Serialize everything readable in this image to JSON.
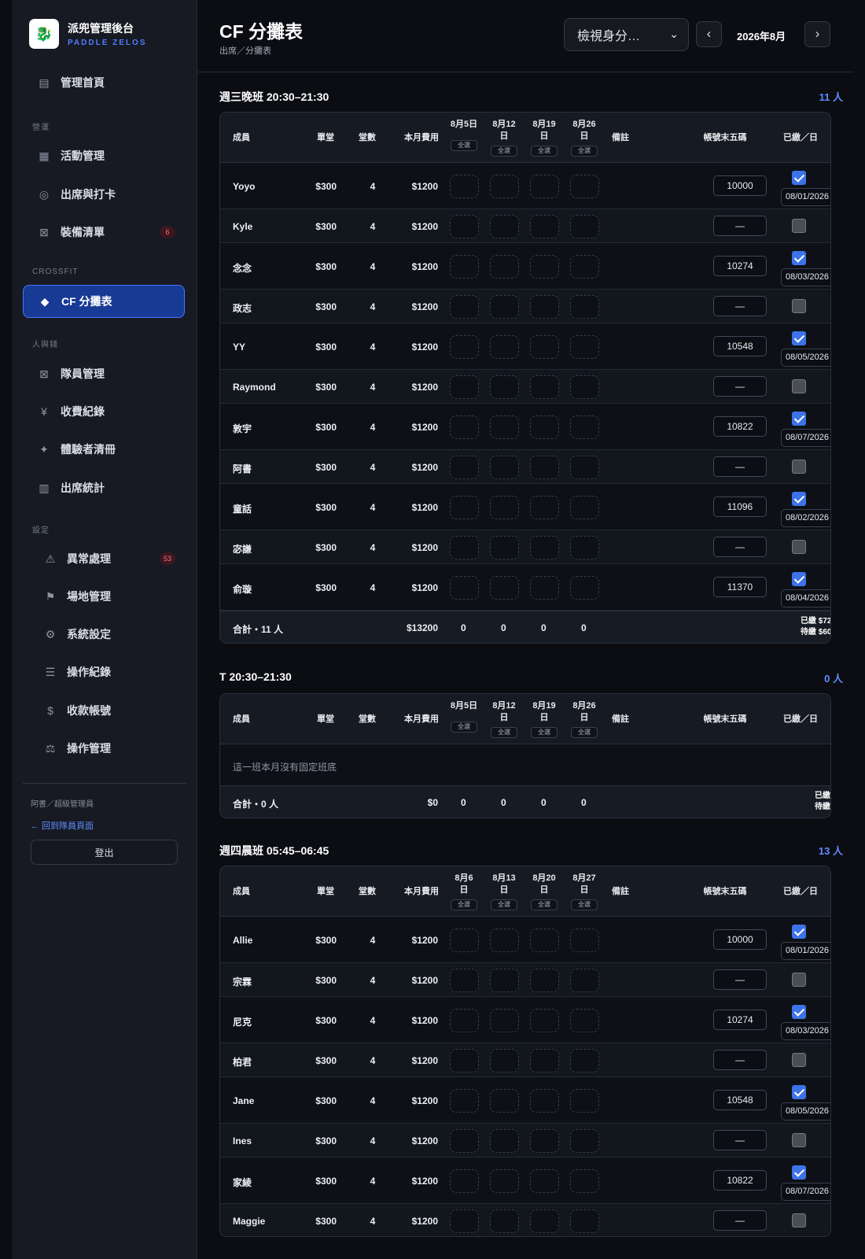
{
  "sidebar": {
    "brand_title": "派兜管理後台",
    "brand_sub": "PADDLE ZELOS",
    "logo_text": "🐉",
    "sections": {
      "ops": "營運",
      "crossfit": "CROSSFIT",
      "people": "人與錢",
      "settings": "設定"
    },
    "items": [
      {
        "label": "管理首頁",
        "icon": "▤"
      },
      {
        "label": "活動管理",
        "icon": "▦"
      },
      {
        "label": "出席與打卡",
        "icon": "◎"
      },
      {
        "label": "裝備清單",
        "icon": "⊠",
        "badge": "6"
      },
      {
        "label": "CF 分攤表",
        "icon": "◆"
      },
      {
        "label": "隊員管理",
        "icon": "⊠"
      },
      {
        "label": "收費紀錄",
        "icon": "¥"
      },
      {
        "label": "體驗者清冊",
        "icon": "✦"
      },
      {
        "label": "出席統計",
        "icon": "▥"
      },
      {
        "label": "異常處理",
        "icon": "⚠",
        "badge": "53"
      },
      {
        "label": "場地管理",
        "icon": "⚑"
      },
      {
        "label": "系統設定",
        "icon": "⚙"
      },
      {
        "label": "操作紀錄",
        "icon": "☰"
      },
      {
        "label": "收款帳號",
        "icon": "$"
      },
      {
        "label": "操作管理",
        "icon": "⚖"
      }
    ],
    "user": "阿書／超級管理員",
    "back_link": "← 回到隊員頁面",
    "logout": "登出"
  },
  "header": {
    "title": "CF 分攤表",
    "breadcrumb": "出席／分攤表",
    "select_value": "檢視身分…",
    "prev": "‹",
    "next": "›",
    "month": "2026年8月"
  },
  "table_headers": {
    "member": "成員",
    "price": "單堂",
    "count": "堂數",
    "fee": "本月費用",
    "note": "備註",
    "account": "帳號末五碼",
    "paid": "已繳／日",
    "week_btn": "全選"
  },
  "groups": [
    {
      "title": "週三晚班 20:30–21:30",
      "count": "11 人",
      "days": [
        "8月5日",
        "8月12\n日",
        "8月19\n日",
        "8月26\n日"
      ],
      "members": [
        {
          "name": "Yoyo",
          "price": "$300",
          "count": "4",
          "fee": "$1200",
          "account": "10000",
          "paid": true,
          "date": "08/01/2026"
        },
        {
          "name": "Kyle",
          "price": "$300",
          "count": "4",
          "fee": "$1200",
          "account": "—",
          "paid": false
        },
        {
          "name": "念念",
          "price": "$300",
          "count": "4",
          "fee": "$1200",
          "account": "10274",
          "paid": true,
          "date": "08/03/2026"
        },
        {
          "name": "政志",
          "price": "$300",
          "count": "4",
          "fee": "$1200",
          "account": "—",
          "paid": false
        },
        {
          "name": "YY",
          "price": "$300",
          "count": "4",
          "fee": "$1200",
          "account": "10548",
          "paid": true,
          "date": "08/05/2026"
        },
        {
          "name": "Raymond",
          "price": "$300",
          "count": "4",
          "fee": "$1200",
          "account": "—",
          "paid": false
        },
        {
          "name": "敦宇",
          "price": "$300",
          "count": "4",
          "fee": "$1200",
          "account": "10822",
          "paid": true,
          "date": "08/07/2026"
        },
        {
          "name": "阿書",
          "price": "$300",
          "count": "4",
          "fee": "$1200",
          "account": "—",
          "paid": false
        },
        {
          "name": "童話",
          "price": "$300",
          "count": "4",
          "fee": "$1200",
          "account": "11096",
          "paid": true,
          "date": "08/02/2026"
        },
        {
          "name": "宓謙",
          "price": "$300",
          "count": "4",
          "fee": "$1200",
          "account": "—",
          "paid": false
        },
        {
          "name": "俞璇",
          "price": "$300",
          "count": "4",
          "fee": "$1200",
          "account": "11370",
          "paid": true,
          "date": "08/04/2026"
        }
      ],
      "footer": {
        "label": "合計・11 人",
        "total": "$13200",
        "days": [
          "0",
          "0",
          "0",
          "0"
        ],
        "summary": [
          "已繳 $72",
          "待繳 $60"
        ]
      }
    },
    {
      "title": "T 20:30–21:30",
      "count": "0 人",
      "days": [
        "8月5日",
        "8月12\n日",
        "8月19\n日",
        "8月26\n日"
      ],
      "empty": "這一班本月沒有固定班底",
      "members": [],
      "footer": {
        "label": "合計・0 人",
        "total": "$0",
        "days": [
          "0",
          "0",
          "0",
          "0"
        ],
        "summary": [
          "已繳",
          "待繳"
        ]
      }
    },
    {
      "title": "週四晨班 05:45–06:45",
      "count": "13 人",
      "days": [
        "8月6\n日",
        "8月13\n日",
        "8月20\n日",
        "8月27\n日"
      ],
      "members": [
        {
          "name": "Allie",
          "price": "$300",
          "count": "4",
          "fee": "$1200",
          "account": "10000",
          "paid": true,
          "date": "08/01/2026"
        },
        {
          "name": "宗霖",
          "price": "$300",
          "count": "4",
          "fee": "$1200",
          "account": "—",
          "paid": false
        },
        {
          "name": "尼克",
          "price": "$300",
          "count": "4",
          "fee": "$1200",
          "account": "10274",
          "paid": true,
          "date": "08/03/2026"
        },
        {
          "name": "柏君",
          "price": "$300",
          "count": "4",
          "fee": "$1200",
          "account": "—",
          "paid": false
        },
        {
          "name": "Jane",
          "price": "$300",
          "count": "4",
          "fee": "$1200",
          "account": "10548",
          "paid": true,
          "date": "08/05/2026"
        },
        {
          "name": "Ines",
          "price": "$300",
          "count": "4",
          "fee": "$1200",
          "account": "—",
          "paid": false
        },
        {
          "name": "家綾",
          "price": "$300",
          "count": "4",
          "fee": "$1200",
          "account": "10822",
          "paid": true,
          "date": "08/07/2026"
        },
        {
          "name": "Maggie",
          "price": "$300",
          "count": "4",
          "fee": "$1200",
          "account": "—",
          "paid": false
        }
      ]
    }
  ]
}
